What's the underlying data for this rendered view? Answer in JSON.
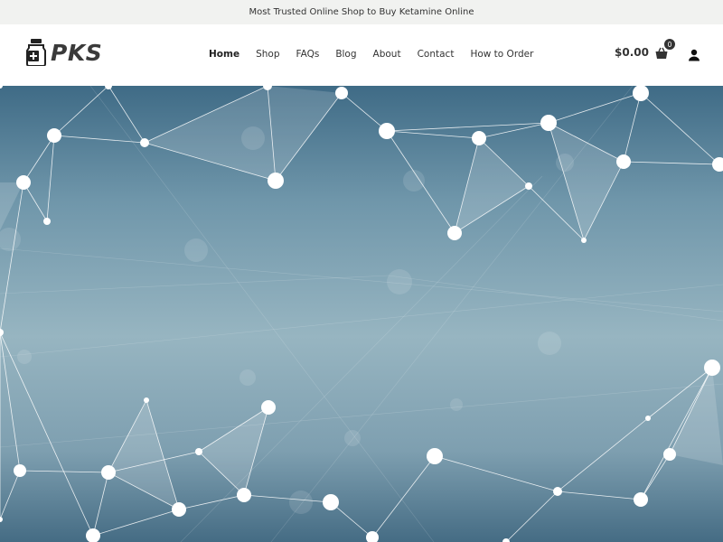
{
  "topbar": {
    "text": "Most Trusted Online Shop to Buy Ketamine Online"
  },
  "logo": {
    "text": "PKS",
    "icon": "medicine-bottle-icon"
  },
  "nav": {
    "items": [
      {
        "label": "Home",
        "active": true
      },
      {
        "label": "Shop"
      },
      {
        "label": "FAQs"
      },
      {
        "label": "Blog"
      },
      {
        "label": "About"
      },
      {
        "label": "Contact"
      },
      {
        "label": "How to Order"
      }
    ]
  },
  "cart": {
    "amount": "$0.00",
    "count": "0",
    "icon": "shopping-basket-icon"
  },
  "account": {
    "icon": "user-icon"
  },
  "colors": {
    "hero_top": "#3f6b86",
    "hero_mid": "#8fb0be",
    "hero_bottom": "#4a7189",
    "accent": "#333333"
  }
}
